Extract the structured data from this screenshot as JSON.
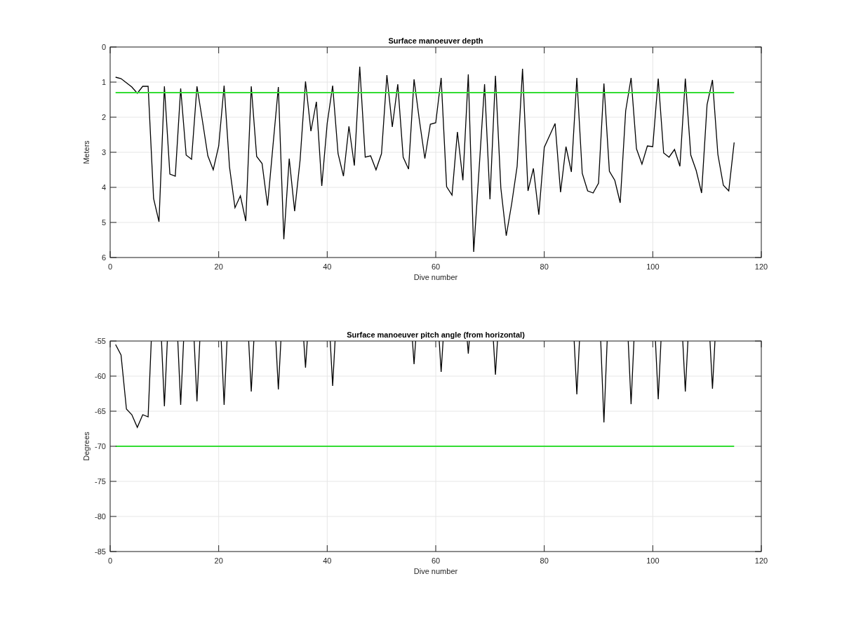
{
  "charts": [
    {
      "chart_data": {
        "type": "line",
        "title": "Surface manoeuver depth",
        "xlabel": "Dive number",
        "ylabel": "Meters",
        "xlim": [
          0,
          120
        ],
        "ylim": [
          6,
          0
        ],
        "grid": true,
        "xticks": [
          0,
          20,
          40,
          60,
          80,
          100,
          120
        ],
        "yticks": [
          0,
          1,
          2,
          3,
          4,
          5,
          6
        ],
        "x": [
          1,
          2,
          3,
          4,
          5,
          6,
          7,
          8,
          9,
          10,
          11,
          12,
          13,
          14,
          15,
          16,
          17,
          18,
          19,
          20,
          21,
          22,
          23,
          24,
          25,
          26,
          27,
          28,
          29,
          30,
          31,
          32,
          33,
          34,
          35,
          36,
          37,
          38,
          39,
          40,
          41,
          42,
          43,
          44,
          45,
          46,
          47,
          48,
          49,
          50,
          51,
          52,
          53,
          54,
          55,
          56,
          57,
          58,
          59,
          60,
          61,
          62,
          63,
          64,
          65,
          66,
          67,
          68,
          69,
          70,
          71,
          72,
          73,
          74,
          75,
          76,
          77,
          78,
          79,
          80,
          81,
          82,
          83,
          84,
          85,
          86,
          87,
          88,
          89,
          90,
          91,
          92,
          93,
          94,
          95,
          96,
          97,
          98,
          99,
          100,
          101,
          102,
          103,
          104,
          105,
          106,
          107,
          108,
          109,
          110,
          111,
          112,
          113,
          114,
          115
        ],
        "series": [
          {
            "color": "#000000",
            "values": [
              0.86,
              0.9,
              1.02,
              1.14,
              1.32,
              1.12,
              1.12,
              4.32,
              4.98,
              1.12,
              3.62,
              3.68,
              1.18,
              3.08,
              3.2,
              1.12,
              2.1,
              3.1,
              3.5,
              2.82,
              1.1,
              3.42,
              4.58,
              4.24,
              4.96,
              1.12,
              3.12,
              3.32,
              4.52,
              2.82,
              1.14,
              5.48,
              3.18,
              4.68,
              3.22,
              0.98,
              2.4,
              1.56,
              3.96,
              2.18,
              1.1,
              3.04,
              3.68,
              2.26,
              3.38,
              0.56,
              3.14,
              3.1,
              3.5,
              3.04,
              0.8,
              2.28,
              1.06,
              3.14,
              3.48,
              0.92,
              2.1,
              3.18,
              2.2,
              2.16,
              0.88,
              3.98,
              4.22,
              2.42,
              3.8,
              0.78,
              5.84,
              3.45,
              1.06,
              4.34,
              0.82,
              4.02,
              5.38,
              4.46,
              3.4,
              0.62,
              4.1,
              3.46,
              4.78,
              2.86,
              2.52,
              2.18,
              4.14,
              2.84,
              3.56,
              0.88,
              3.6,
              4.1,
              4.16,
              3.88,
              1.04,
              3.54,
              3.8,
              4.44,
              1.82,
              0.88,
              2.9,
              3.34,
              2.82,
              2.84,
              0.9,
              3.02,
              3.14,
              2.92,
              3.4,
              0.9,
              3.08,
              3.52,
              4.16,
              1.64,
              0.94,
              3.06,
              3.94,
              4.1,
              2.72
            ]
          },
          {
            "color": "#33dd33",
            "values": [
              1.3,
              1.3,
              1.3,
              1.3,
              1.3,
              1.3,
              1.3,
              1.3,
              1.3,
              1.3,
              1.3,
              1.3,
              1.3,
              1.3,
              1.3,
              1.3,
              1.3,
              1.3,
              1.3,
              1.3,
              1.3,
              1.3,
              1.3,
              1.3,
              1.3,
              1.3,
              1.3,
              1.3,
              1.3,
              1.3,
              1.3,
              1.3,
              1.3,
              1.3,
              1.3,
              1.3,
              1.3,
              1.3,
              1.3,
              1.3,
              1.3,
              1.3,
              1.3,
              1.3,
              1.3,
              1.3,
              1.3,
              1.3,
              1.3,
              1.3,
              1.3,
              1.3,
              1.3,
              1.3,
              1.3,
              1.3,
              1.3,
              1.3,
              1.3,
              1.3,
              1.3,
              1.3,
              1.3,
              1.3,
              1.3,
              1.3,
              1.3,
              1.3,
              1.3,
              1.3,
              1.3,
              1.3,
              1.3,
              1.3,
              1.3,
              1.3,
              1.3,
              1.3,
              1.3,
              1.3,
              1.3,
              1.3,
              1.3,
              1.3,
              1.3,
              1.3,
              1.3,
              1.3,
              1.3,
              1.3,
              1.3,
              1.3,
              1.3,
              1.3,
              1.3,
              1.3,
              1.3,
              1.3,
              1.3,
              1.3,
              1.3,
              1.3,
              1.3,
              1.3,
              1.3,
              1.3,
              1.3,
              1.3,
              1.3,
              1.3,
              1.3,
              1.3,
              1.3,
              1.3,
              1.3
            ]
          }
        ]
      }
    },
    {
      "chart_data": {
        "type": "line",
        "title": "Surface manoeuver pitch angle (from horizontal)",
        "xlabel": "Dive number",
        "ylabel": "Degrees",
        "xlim": [
          0,
          120
        ],
        "ylim": [
          -85,
          -55
        ],
        "grid": true,
        "xticks": [
          0,
          20,
          40,
          60,
          80,
          100,
          120
        ],
        "yticks": [
          -85,
          -80,
          -75,
          -70,
          -65,
          -60,
          -55
        ],
        "x": [
          1,
          2,
          3,
          4,
          5,
          6,
          7,
          8,
          9,
          10,
          11,
          12,
          13,
          14,
          15,
          16,
          17,
          18,
          19,
          20,
          21,
          22,
          23,
          24,
          25,
          26,
          27,
          28,
          29,
          30,
          31,
          32,
          33,
          34,
          35,
          36,
          37,
          38,
          39,
          40,
          41,
          42,
          43,
          44,
          45,
          46,
          47,
          48,
          49,
          50,
          51,
          52,
          53,
          54,
          55,
          56,
          57,
          58,
          59,
          60,
          61,
          62,
          63,
          64,
          65,
          66,
          67,
          68,
          69,
          70,
          71,
          72,
          73,
          74,
          75,
          76,
          77,
          78,
          79,
          80,
          81,
          82,
          83,
          84,
          85,
          86,
          87,
          88,
          89,
          90,
          91,
          92,
          93,
          94,
          95,
          96,
          97,
          98,
          99,
          100,
          101,
          102,
          103,
          104,
          105,
          106,
          107,
          108,
          109,
          110,
          111,
          112,
          113,
          114,
          115
        ],
        "series": [
          {
            "color": "#000000",
            "values": [
              -55.5,
              -57,
              -64.7,
              -65.5,
              -67.3,
              -65.5,
              -65.8,
              null,
              null,
              -64.3,
              null,
              null,
              -64.1,
              null,
              null,
              -63.6,
              null,
              null,
              null,
              null,
              -64.1,
              null,
              null,
              null,
              null,
              -62.2,
              null,
              null,
              null,
              null,
              -61.9,
              null,
              null,
              null,
              null,
              -58.8,
              null,
              null,
              null,
              null,
              -61.4,
              null,
              null,
              null,
              null,
              null,
              null,
              null,
              null,
              null,
              null,
              null,
              null,
              null,
              null,
              -58.3,
              null,
              null,
              null,
              null,
              -59.4,
              null,
              null,
              null,
              null,
              -56.8,
              null,
              null,
              null,
              null,
              -59.8,
              null,
              null,
              null,
              null,
              null,
              null,
              null,
              null,
              null,
              null,
              null,
              null,
              null,
              null,
              -62.6,
              null,
              null,
              null,
              null,
              -66.6,
              null,
              null,
              null,
              null,
              -64.0,
              null,
              null,
              null,
              null,
              -63.3,
              null,
              null,
              null,
              null,
              -62.2,
              null,
              null,
              null,
              null,
              -61.8,
              null,
              null,
              null,
              null
            ]
          },
          {
            "color": "#33dd33",
            "values": [
              -70,
              -70,
              -70,
              -70,
              -70,
              -70,
              -70,
              -70,
              -70,
              -70,
              -70,
              -70,
              -70,
              -70,
              -70,
              -70,
              -70,
              -70,
              -70,
              -70,
              -70,
              -70,
              -70,
              -70,
              -70,
              -70,
              -70,
              -70,
              -70,
              -70,
              -70,
              -70,
              -70,
              -70,
              -70,
              -70,
              -70,
              -70,
              -70,
              -70,
              -70,
              -70,
              -70,
              -70,
              -70,
              -70,
              -70,
              -70,
              -70,
              -70,
              -70,
              -70,
              -70,
              -70,
              -70,
              -70,
              -70,
              -70,
              -70,
              -70,
              -70,
              -70,
              -70,
              -70,
              -70,
              -70,
              -70,
              -70,
              -70,
              -70,
              -70,
              -70,
              -70,
              -70,
              -70,
              -70,
              -70,
              -70,
              -70,
              -70,
              -70,
              -70,
              -70,
              -70,
              -70,
              -70,
              -70,
              -70,
              -70,
              -70,
              -70,
              -70,
              -70,
              -70,
              -70,
              -70,
              -70,
              -70,
              -70,
              -70,
              -70,
              -70,
              -70,
              -70,
              -70,
              -70,
              -70,
              -70,
              -70,
              -70,
              -70,
              -70,
              -70,
              -70,
              -70
            ]
          }
        ]
      }
    }
  ]
}
